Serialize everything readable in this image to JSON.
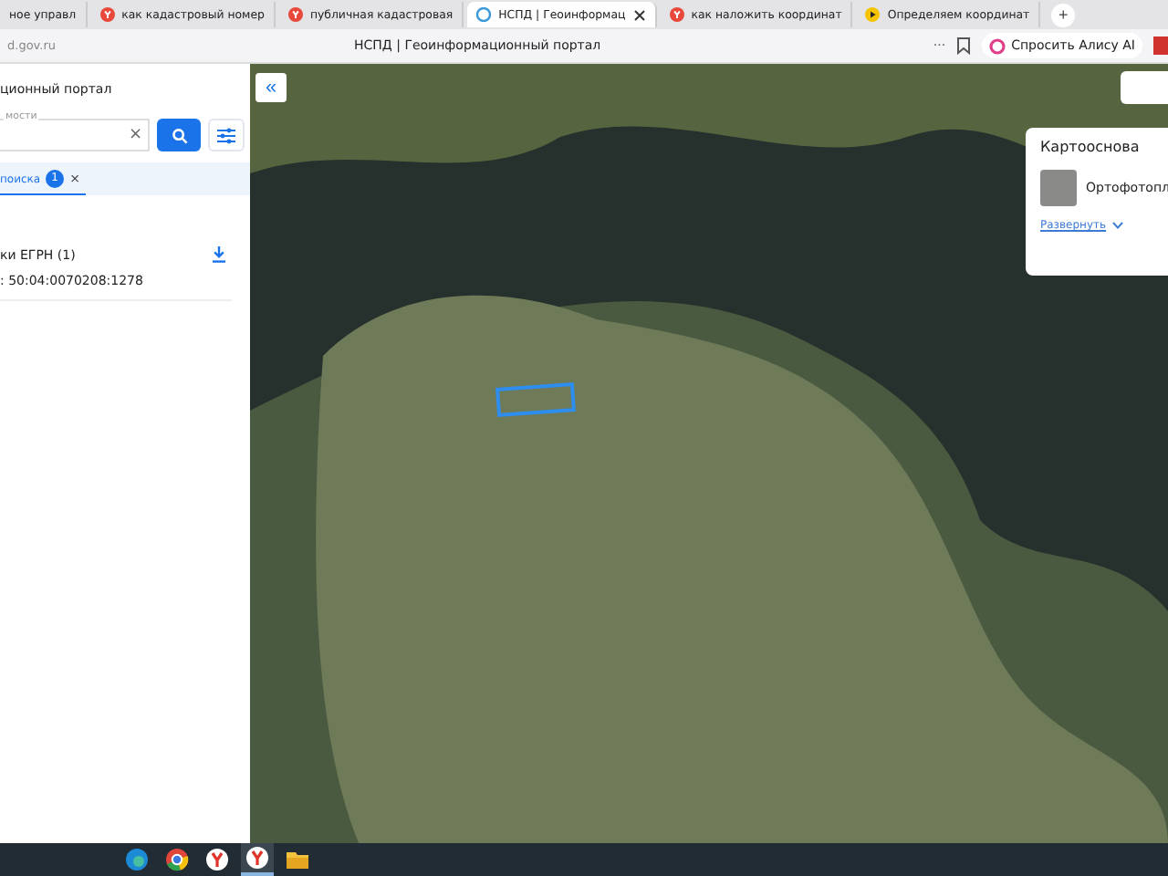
{
  "browser": {
    "tabs": [
      {
        "label": "ное управл",
        "selected": false,
        "kind": "plain"
      },
      {
        "label": "как кадастровый номер",
        "selected": false,
        "kind": "yandex"
      },
      {
        "label": "публичная кадастровая",
        "selected": false,
        "kind": "yandex"
      },
      {
        "label": "НСПД | Геоинформац",
        "selected": true,
        "kind": "site"
      },
      {
        "label": "как наложить координат",
        "selected": false,
        "kind": "yandex"
      },
      {
        "label": "Определяем координат",
        "selected": false,
        "kind": "play"
      }
    ],
    "new_tab": "+",
    "address": "d.gov.ru",
    "page_title": "НСПД | Геоинформационный портал",
    "more": "···",
    "ask_button": "Спросить Алису AI"
  },
  "sidebar": {
    "title": "ционный портал",
    "search": {
      "label": "мости",
      "clear": "×"
    },
    "result_tab": {
      "label": "поиска",
      "count": "1",
      "close": "×",
      "selected": true
    },
    "section_title": "ки ЕГРН (1)",
    "result": ": 50:04:0070208:1278"
  },
  "map": {
    "collapse": "«",
    "basemap_card": {
      "title": "Картооснова",
      "layer": "Ортофотопл",
      "expand_link": "Развернуть"
    }
  },
  "taskbar": {
    "apps": [
      {
        "kind": "edge",
        "selected": false
      },
      {
        "kind": "chrome",
        "selected": false
      },
      {
        "kind": "yandex",
        "selected": false
      },
      {
        "kind": "yandex",
        "selected": true
      },
      {
        "kind": "folder",
        "selected": false
      }
    ]
  }
}
